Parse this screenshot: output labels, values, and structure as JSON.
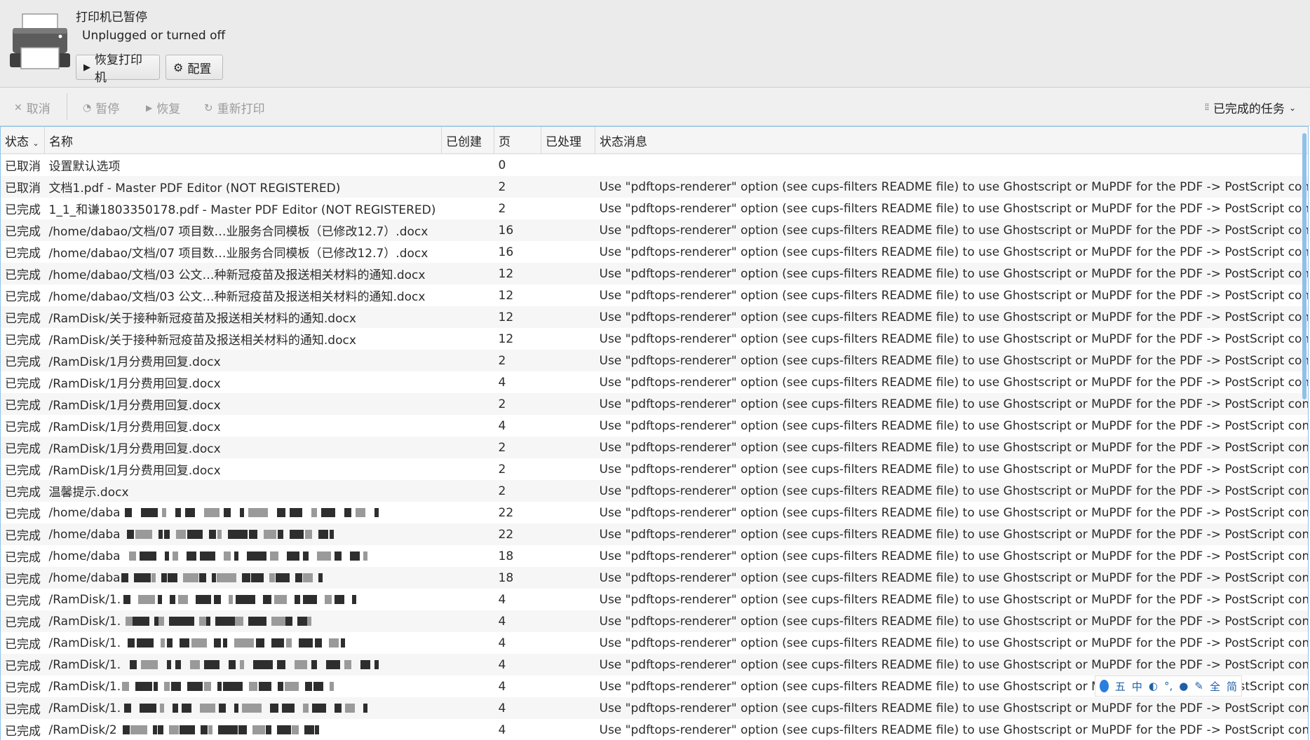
{
  "header": {
    "printer_name": "打印机已暂停",
    "printer_status": "Unplugged or turned off",
    "resume_label": "恢复打印机",
    "config_label": "配置"
  },
  "toolbar": {
    "cancel": "取消",
    "pause": "暂停",
    "resume": "恢复",
    "reprint": "重新打印",
    "filter": "已完成的任务"
  },
  "table": {
    "columns": {
      "state": "状态",
      "name": "名称",
      "created": "已创建",
      "pages": "页",
      "processed": "已处理",
      "message": "状态消息"
    },
    "rows": [
      {
        "state": "已取消",
        "name": "设置默认选项",
        "pages": "0",
        "message": ""
      },
      {
        "state": "已取消",
        "name": "文档1.pdf - Master PDF Editor (NOT REGISTERED)",
        "pages": "2",
        "message": "Use \"pdftops-renderer\" option (see cups-filters README file) to use Ghostscript or MuPDF for the PDF -> PostScript conversion."
      },
      {
        "state": "已完成",
        "name": "1_1_和谦1803350178.pdf - Master PDF Editor (NOT REGISTERED)",
        "pages": "2",
        "message": "Use \"pdftops-renderer\" option (see cups-filters README file) to use Ghostscript or MuPDF for the PDF -> PostScript conversion."
      },
      {
        "state": "已完成",
        "name": "/home/dabao/文档/07 项目数…业服务合同模板（已修改12.7）.docx",
        "pages": "16",
        "message": "Use \"pdftops-renderer\" option (see cups-filters README file) to use Ghostscript or MuPDF for the PDF -> PostScript conversion."
      },
      {
        "state": "已完成",
        "name": "/home/dabao/文档/07 项目数…业服务合同模板（已修改12.7）.docx",
        "pages": "16",
        "message": "Use \"pdftops-renderer\" option (see cups-filters README file) to use Ghostscript or MuPDF for the PDF -> PostScript conversion."
      },
      {
        "state": "已完成",
        "name": "/home/dabao/文档/03 公文…种新冠疫苗及报送相关材料的通知.docx",
        "pages": "12",
        "message": "Use \"pdftops-renderer\" option (see cups-filters README file) to use Ghostscript or MuPDF for the PDF -> PostScript conversion."
      },
      {
        "state": "已完成",
        "name": "/home/dabao/文档/03 公文…种新冠疫苗及报送相关材料的通知.docx",
        "pages": "12",
        "message": "Use \"pdftops-renderer\" option (see cups-filters README file) to use Ghostscript or MuPDF for the PDF -> PostScript conversion."
      },
      {
        "state": "已完成",
        "name": "/RamDisk/关于接种新冠疫苗及报送相关材料的通知.docx",
        "pages": "12",
        "message": "Use \"pdftops-renderer\" option (see cups-filters README file) to use Ghostscript or MuPDF for the PDF -> PostScript conversion."
      },
      {
        "state": "已完成",
        "name": "/RamDisk/关于接种新冠疫苗及报送相关材料的通知.docx",
        "pages": "12",
        "message": "Use \"pdftops-renderer\" option (see cups-filters README file) to use Ghostscript or MuPDF for the PDF -> PostScript conversion."
      },
      {
        "state": "已完成",
        "name": "/RamDisk/1月分费用回复.docx",
        "pages": "2",
        "message": "Use \"pdftops-renderer\" option (see cups-filters README file) to use Ghostscript or MuPDF for the PDF -> PostScript conversion."
      },
      {
        "state": "已完成",
        "name": "/RamDisk/1月分费用回复.docx",
        "pages": "4",
        "message": "Use \"pdftops-renderer\" option (see cups-filters README file) to use Ghostscript or MuPDF for the PDF -> PostScript conversion."
      },
      {
        "state": "已完成",
        "name": "/RamDisk/1月分费用回复.docx",
        "pages": "2",
        "message": "Use \"pdftops-renderer\" option (see cups-filters README file) to use Ghostscript or MuPDF for the PDF -> PostScript conversion."
      },
      {
        "state": "已完成",
        "name": "/RamDisk/1月分费用回复.docx",
        "pages": "4",
        "message": "Use \"pdftops-renderer\" option (see cups-filters README file) to use Ghostscript or MuPDF for the PDF -> PostScript conversion."
      },
      {
        "state": "已完成",
        "name": "/RamDisk/1月分费用回复.docx",
        "pages": "2",
        "message": "Use \"pdftops-renderer\" option (see cups-filters README file) to use Ghostscript or MuPDF for the PDF -> PostScript conversion."
      },
      {
        "state": "已完成",
        "name": "/RamDisk/1月分费用回复.docx",
        "pages": "2",
        "message": "Use \"pdftops-renderer\" option (see cups-filters README file) to use Ghostscript or MuPDF for the PDF -> PostScript conversion."
      },
      {
        "state": "已完成",
        "name": "温馨提示.docx",
        "pages": "2",
        "message": "Use \"pdftops-renderer\" option (see cups-filters README file) to use Ghostscript or MuPDF for the PDF -> PostScript conversion."
      },
      {
        "state": "已完成",
        "name": "/home/daba",
        "redacted": true,
        "pages": "22",
        "message": "Use \"pdftops-renderer\" option (see cups-filters README file) to use Ghostscript or MuPDF for the PDF -> PostScript conversion."
      },
      {
        "state": "已完成",
        "name": "/home/daba",
        "redacted": true,
        "pages": "22",
        "message": "Use \"pdftops-renderer\" option (see cups-filters README file) to use Ghostscript or MuPDF for the PDF -> PostScript conversion."
      },
      {
        "state": "已完成",
        "name": "/home/daba",
        "redacted": true,
        "pages": "18",
        "message": "Use \"pdftops-renderer\" option (see cups-filters README file) to use Ghostscript or MuPDF for the PDF -> PostScript conversion."
      },
      {
        "state": "已完成",
        "name": "/home/daba",
        "redacted": true,
        "pages": "18",
        "message": "Use \"pdftops-renderer\" option (see cups-filters README file) to use Ghostscript or MuPDF for the PDF -> PostScript conversion."
      },
      {
        "state": "已完成",
        "name": "/RamDisk/1.",
        "redacted": true,
        "pages": "4",
        "message": "Use \"pdftops-renderer\" option (see cups-filters README file) to use Ghostscript or MuPDF for the PDF -> PostScript conversion."
      },
      {
        "state": "已完成",
        "name": "/RamDisk/1.",
        "redacted": true,
        "pages": "4",
        "message": "Use \"pdftops-renderer\" option (see cups-filters README file) to use Ghostscript or MuPDF for the PDF -> PostScript conversion."
      },
      {
        "state": "已完成",
        "name": "/RamDisk/1.",
        "redacted": true,
        "pages": "4",
        "message": "Use \"pdftops-renderer\" option (see cups-filters README file) to use Ghostscript or MuPDF for the PDF -> PostScript conversion."
      },
      {
        "state": "已完成",
        "name": "/RamDisk/1.",
        "redacted": true,
        "pages": "4",
        "message": "Use \"pdftops-renderer\" option (see cups-filters README file) to use Ghostscript or MuPDF for the PDF -> PostScript conversion."
      },
      {
        "state": "已完成",
        "name": "/RamDisk/1.",
        "redacted": true,
        "pages": "4",
        "message": "Use \"pdftops-renderer\" option (see cups-filters README file) to use Ghostscript or MuPDF for the PDF -> PostScript conversion."
      },
      {
        "state": "已完成",
        "name": "/RamDisk/1.",
        "redacted": true,
        "pages": "4",
        "message": "Use \"pdftops-renderer\" option (see cups-filters README file) to use Ghostscript or MuPDF for the PDF -> PostScript conversion."
      },
      {
        "state": "已完成",
        "name": "/RamDisk/2",
        "redacted": true,
        "pages": "4",
        "message": "Use \"pdftops-renderer\" option (see cups-filters README file) to use Ghostscript or MuPDF for the PDF -> PostScript conversion."
      }
    ]
  },
  "ime_bar": {
    "chars": [
      "五",
      "中",
      "全",
      "简"
    ]
  }
}
